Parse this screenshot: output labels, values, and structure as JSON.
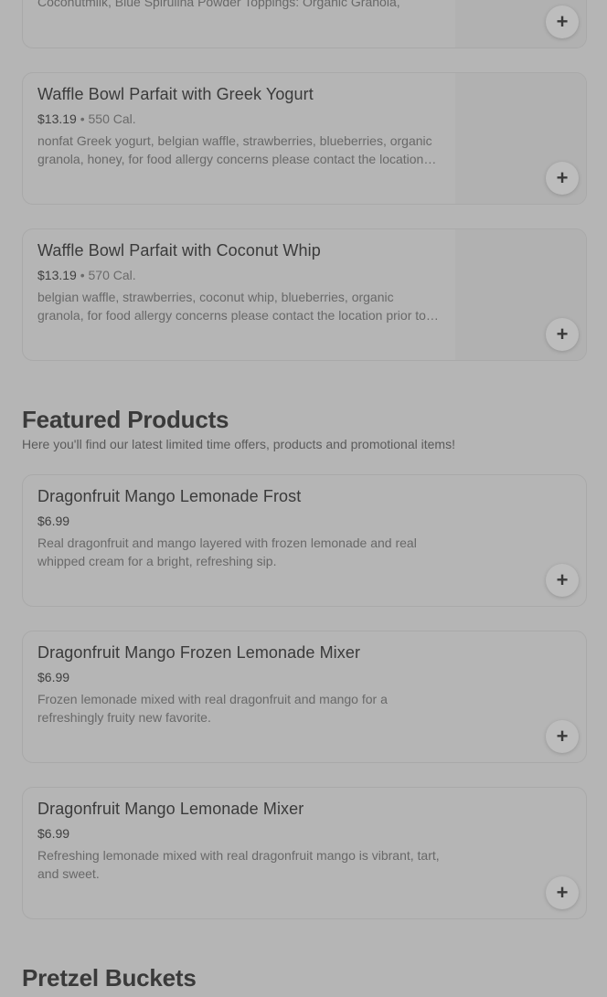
{
  "top_partial": {
    "desc": "Coconutmilk, Blue Spirulina Powder Toppings: Organic Granola,"
  },
  "cards_top": [
    {
      "title": "Waffle Bowl Parfait with Greek Yogurt",
      "price": "$13.19",
      "calories": "550 Cal.",
      "desc": "nonfat Greek yogurt, belgian waffle, strawberries, blueberries, organic granola, honey, for food allergy concerns please contact the location prior to ordering"
    },
    {
      "title": "Waffle Bowl Parfait with Coconut Whip",
      "price": "$13.19",
      "calories": "570 Cal.",
      "desc": "belgian waffle, strawberries, coconut whip, blueberries, organic granola, for food allergy concerns please contact the location prior to ordering"
    }
  ],
  "featured": {
    "title": "Featured Products",
    "subtitle": "Here you'll find our latest limited time offers, products and promotional items!",
    "items": [
      {
        "title": "Dragonfruit Mango Lemonade Frost",
        "price": "$6.99",
        "desc": "Real dragonfruit and mango layered with frozen lemonade and real whipped cream for a bright, refreshing sip."
      },
      {
        "title": "Dragonfruit Mango Frozen Lemonade Mixer",
        "price": "$6.99",
        "desc": "Frozen lemonade mixed with real dragonfruit and mango for a refreshingly fruity new favorite."
      },
      {
        "title": "Dragonfruit Mango Lemonade Mixer",
        "price": "$6.99",
        "desc": "Refreshing lemonade mixed with real dragonfruit mango is vibrant, tart, and sweet."
      }
    ]
  },
  "next_section": {
    "title": "Pretzel Buckets"
  },
  "icons": {
    "add": "plus-icon"
  },
  "add_glyph": "+",
  "price_separator": "•"
}
